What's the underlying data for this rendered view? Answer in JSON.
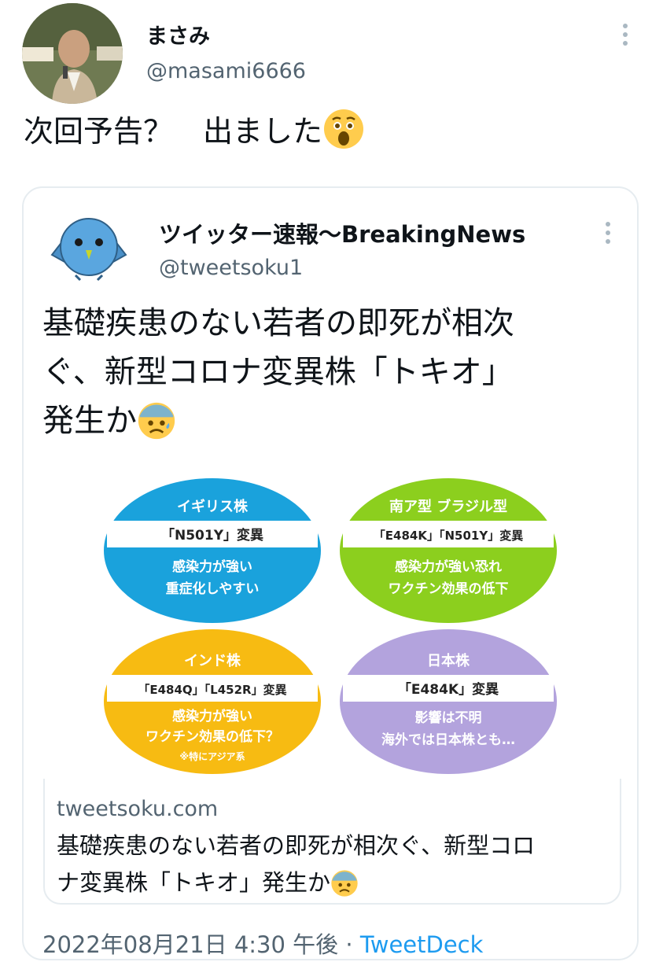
{
  "author": {
    "name": "まさみ",
    "handle": "@masami6666"
  },
  "tweet": {
    "text": "次回予告？　出ました",
    "emoji": "astonished-face"
  },
  "quoted": {
    "name": "ツイッター速報〜BreakingNews",
    "handle": "@tweetsoku1",
    "lines": [
      "基礎疾患のない若者の即死が相次",
      "ぐ、新型コロナ変異株「トキオ」",
      "発生か"
    ],
    "emoji": "anxious-face-with-sweat",
    "image": {
      "variants": [
        {
          "title": "イギリス株",
          "code": "「N501Y」変異",
          "desc1": "感染力が強い",
          "desc2": "重症化しやすい",
          "color": "#1aa2dc"
        },
        {
          "title": "南ア型 ブラジル型",
          "code": "「E484K」「N501Y」変異",
          "desc1": "感染力が強い恐れ",
          "desc2": "ワクチン効果の低下",
          "color": "#8ccf1e"
        },
        {
          "title": "インド株",
          "code": "「E484Q」「L452R」変異",
          "desc1": "感染力が強い",
          "desc2": "ワクチン効果の低下？",
          "note": "※特にアジア系",
          "color": "#f7bb12"
        },
        {
          "title": "日本株",
          "code": "「E484K」変異",
          "desc1": "影響は不明",
          "desc2": "海外では日本株とも…",
          "color": "#b3a3dd"
        }
      ]
    },
    "card": {
      "domain": "tweetsoku.com",
      "line1": "基礎疾患のない若者の即死が相次ぐ、新型コロ",
      "line2": "ナ変異株「トキオ」発生か"
    }
  },
  "meta": {
    "timestamp": "2022年08月21日 4:30 午後",
    "separator": " · ",
    "source": "TweetDeck"
  }
}
